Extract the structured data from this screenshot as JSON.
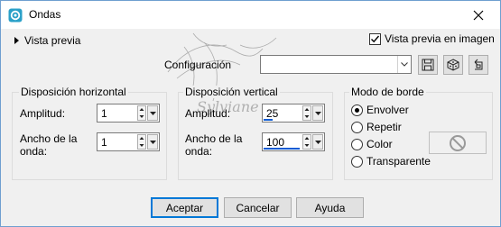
{
  "window": {
    "title": "Ondas"
  },
  "preview": {
    "label": "Vista previa",
    "checkbox_label": "Vista previa en imagen",
    "checked": true
  },
  "config": {
    "label": "Configuración",
    "value": ""
  },
  "horizontal": {
    "title": "Disposición horizontal",
    "amplitude_label": "Amplitud:",
    "amplitude_value": "1",
    "wavelength_label_1": "Ancho de la",
    "wavelength_label_2": "onda:",
    "wavelength_value": "1"
  },
  "vertical": {
    "title": "Disposición vertical",
    "amplitude_label": "Amplitud:",
    "amplitude_value": "25",
    "amplitude_level": 0.25,
    "wavelength_label_1": "Ancho de la",
    "wavelength_label_2": "onda:",
    "wavelength_value": "100",
    "wavelength_level": 1.0
  },
  "edge": {
    "title": "Modo de borde",
    "options": [
      "Envolver",
      "Repetir",
      "Color",
      "Transparente"
    ],
    "selected": "Envolver"
  },
  "buttons": {
    "ok": "Aceptar",
    "cancel": "Cancelar",
    "help": "Ayuda"
  },
  "colors": {
    "accent": "#0078d7",
    "spin_level": "#0b5bd3"
  }
}
